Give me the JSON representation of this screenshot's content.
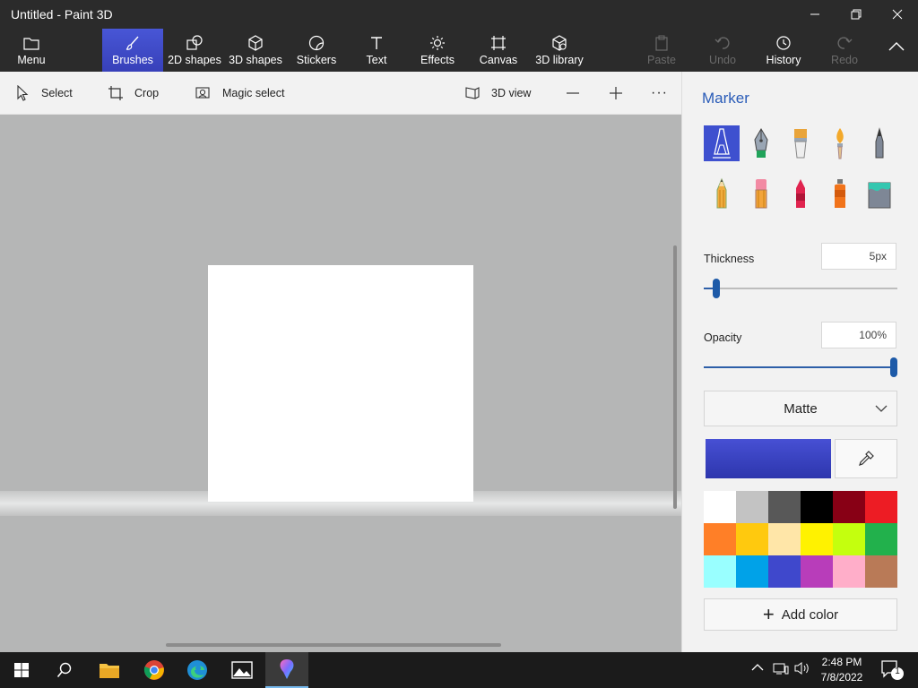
{
  "window": {
    "title": "Untitled - Paint 3D",
    "minimize": "—",
    "maximize": "❐",
    "close": "✕"
  },
  "ribbon": {
    "menu": "Menu",
    "brushes": "Brushes",
    "shapes2d": "2D shapes",
    "shapes3d": "3D shapes",
    "stickers": "Stickers",
    "text": "Text",
    "effects": "Effects",
    "canvas": "Canvas",
    "library3d": "3D library",
    "paste": "Paste",
    "undo": "Undo",
    "history": "History",
    "redo": "Redo"
  },
  "commandbar": {
    "select": "Select",
    "crop": "Crop",
    "magic_select": "Magic select",
    "view3d": "3D view",
    "more": "···"
  },
  "panel": {
    "title": "Marker",
    "thickness_label": "Thickness",
    "thickness_value": "5px",
    "thickness_level": 0.05,
    "opacity_label": "Opacity",
    "opacity_value": "100%",
    "opacity_level": 1.0,
    "finish": "Matte",
    "selected_color": "#4750d4",
    "add_color": "Add color",
    "palette": [
      "#ffffff",
      "#c3c3c3",
      "#585858",
      "#000000",
      "#880015",
      "#ed1c24",
      "#ff7f27",
      "#ffc90e",
      "#ffe6a8",
      "#fff200",
      "#c4ff0e",
      "#22b14c",
      "#99ffff",
      "#00a2e8",
      "#3f48cc",
      "#b83dba",
      "#ffaec9",
      "#b97a57"
    ]
  },
  "taskbar": {
    "time": "2:48 PM",
    "date": "7/8/2022",
    "notifications": "1"
  },
  "colors": {
    "accent": "#3e50cf",
    "title_bar": "#2b2b2b",
    "panel_title": "#2a5cb8"
  }
}
